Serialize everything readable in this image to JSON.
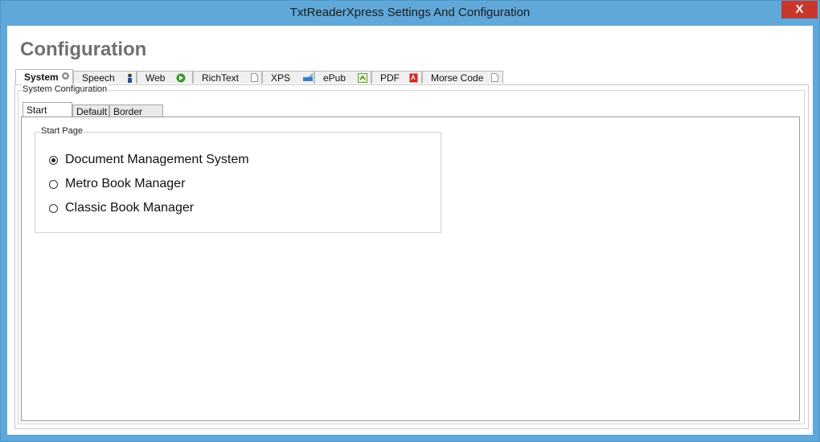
{
  "window": {
    "title": "TxtReaderXpress Settings And Configuration",
    "close_glyph": "X"
  },
  "page": {
    "title": "Configuration"
  },
  "outer_tabs": [
    {
      "label": "System",
      "icon": "gear-icon",
      "active": true
    },
    {
      "label": "Speech",
      "icon": "person-icon",
      "active": false
    },
    {
      "label": "Web",
      "icon": "globe-icon",
      "active": false
    },
    {
      "label": "RichText",
      "icon": "document-icon",
      "active": false
    },
    {
      "label": "XPS",
      "icon": "xps-icon",
      "active": false
    },
    {
      "label": "ePub",
      "icon": "epub-icon",
      "active": false
    },
    {
      "label": "PDF",
      "icon": "pdf-icon",
      "active": false
    },
    {
      "label": "Morse Code",
      "icon": "document-icon",
      "active": false
    }
  ],
  "system_config": {
    "label": "System Configuration"
  },
  "inner_tabs": [
    {
      "label": "Start Page",
      "active": true
    },
    {
      "label": "Default",
      "active": false
    },
    {
      "label": "Border Style",
      "active": false
    }
  ],
  "start_page": {
    "group_label": "Start Page",
    "options": [
      {
        "label": "Document Management System",
        "checked": true
      },
      {
        "label": "Metro Book Manager",
        "checked": false
      },
      {
        "label": "Classic Book Manager",
        "checked": false
      }
    ]
  },
  "colors": {
    "titlebar": "#5fa8d9",
    "close": "#c7372c",
    "page_title": "#707070"
  }
}
